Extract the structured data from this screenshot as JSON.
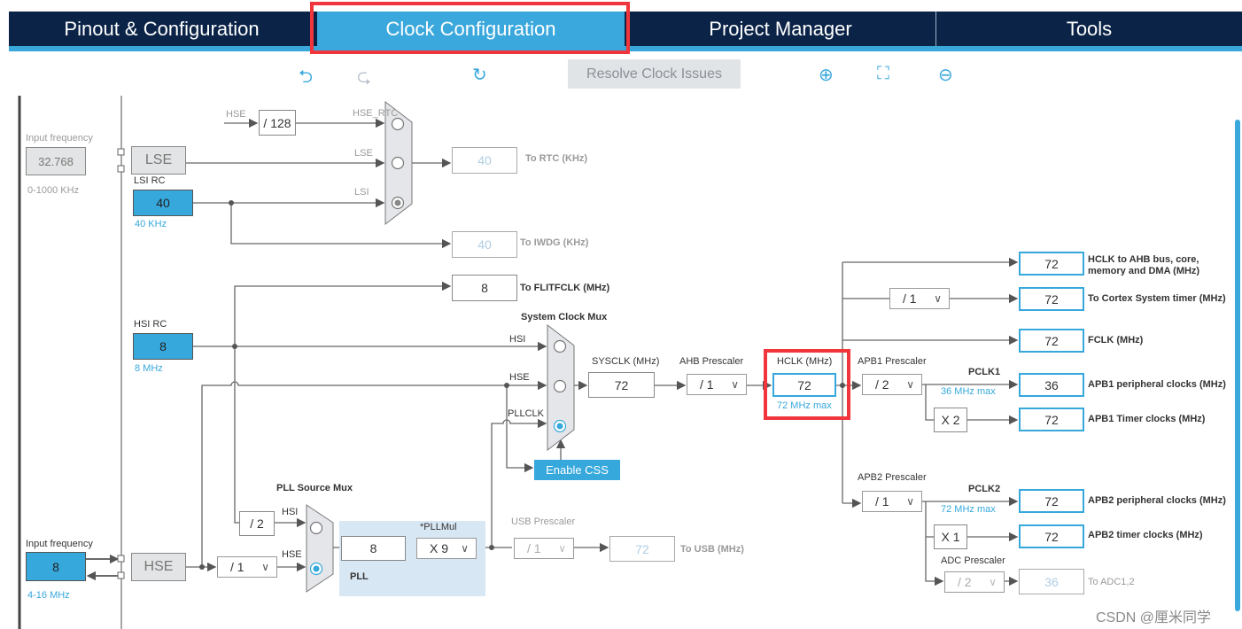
{
  "tabs": [
    {
      "label": "Pinout & Configuration"
    },
    {
      "label": "Clock Configuration",
      "active": true
    },
    {
      "label": "Project Manager"
    },
    {
      "label": "Tools"
    }
  ],
  "toolbar": {
    "undo_icon": "undo-icon",
    "redo_icon": "redo-icon",
    "reset_icon": "refresh-icon",
    "resolve_label": "Resolve Clock Issues",
    "zoom_in_icon": "zoom-in-icon",
    "fit_icon": "fit-screen-icon",
    "zoom_out_icon": "zoom-out-icon"
  },
  "colors": {
    "accent": "#3aa8dc",
    "nav": "#0b2347",
    "highlight": "#f0363c",
    "pll_bg": "#d8e7f4"
  },
  "lse": {
    "input_label": "Input frequency",
    "input_value": "32.768",
    "range": "0-1000 KHz",
    "block": "LSE"
  },
  "lsi": {
    "label": "LSI RC",
    "value": "40",
    "freq": "40 KHz"
  },
  "rtc": {
    "hse_label": "HSE",
    "div": "/ 128",
    "hse_rtc": "HSE_RTC",
    "lse": "LSE",
    "lsi": "LSI",
    "out_value": "40",
    "out_label": "To RTC (KHz)"
  },
  "iwdg": {
    "value": "40",
    "label": "To IWDG (KHz)"
  },
  "flit": {
    "value": "8",
    "label": "To FLITFCLK (MHz)"
  },
  "hsi": {
    "label": "HSI RC",
    "value": "8",
    "freq": "8 MHz"
  },
  "sysmux": {
    "title": "System Clock Mux",
    "hsi": "HSI",
    "hse": "HSE",
    "pllclk": "PLLCLK",
    "css": "Enable CSS"
  },
  "sysclk": {
    "label": "SYSCLK (MHz)",
    "value": "72"
  },
  "ahb": {
    "label": "AHB Prescaler",
    "value": "/ 1"
  },
  "hclk": {
    "label": "HCLK (MHz)",
    "value": "72",
    "max": "72 MHz max"
  },
  "apb1": {
    "label": "APB1 Prescaler",
    "value": "/ 2",
    "pclk": "PCLK1",
    "max": "36 MHz max",
    "timer_mul": "X 2"
  },
  "apb2": {
    "label": "APB2 Prescaler",
    "value": "/ 1",
    "pclk": "PCLK2",
    "max": "72 MHz max",
    "timer_mul": "X 1"
  },
  "cortex_div": "/ 1",
  "outputs": [
    {
      "value": "72",
      "label": "HCLK to AHB bus, core, memory and DMA (MHz)"
    },
    {
      "value": "72",
      "label": "To Cortex System timer (MHz)"
    },
    {
      "value": "72",
      "label": "FCLK (MHz)"
    },
    {
      "value": "36",
      "label": "APB1 peripheral clocks (MHz)"
    },
    {
      "value": "72",
      "label": "APB1 Timer clocks (MHz)"
    },
    {
      "value": "72",
      "label": "APB2 peripheral clocks (MHz)"
    },
    {
      "value": "72",
      "label": "APB2 timer clocks (MHz)"
    }
  ],
  "adc": {
    "label": "ADC Prescaler",
    "value": "/ 2",
    "out_value": "36",
    "out_label": "To ADC1,2"
  },
  "pllmux": {
    "title": "PLL Source Mux",
    "hsi": "HSI",
    "hse": "HSE",
    "hsi_div": "/ 2",
    "hse_div": "/ 1"
  },
  "hse": {
    "input_label": "Input frequency",
    "input_value": "8",
    "range": "4-16 MHz",
    "block": "HSE"
  },
  "pll": {
    "value": "8",
    "mul_label": "*PLLMul",
    "mul": "X 9",
    "label": "PLL"
  },
  "usb": {
    "label": "USB Prescaler",
    "value": "/ 1",
    "out_value": "72",
    "out_label": "To USB (MHz)"
  },
  "watermark": "CSDN @厘米同学"
}
